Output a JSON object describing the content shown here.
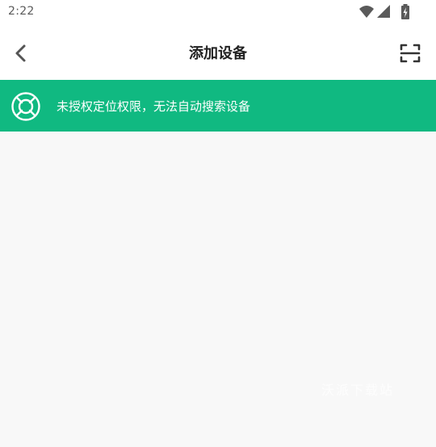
{
  "status_bar": {
    "time": "2:22",
    "icons": [
      "wifi-icon",
      "signal-icon",
      "battery-charging-icon"
    ]
  },
  "app_bar": {
    "title": "添加设备",
    "back_icon": "chevron-left-icon",
    "scan_icon": "scan-frame-icon"
  },
  "banner": {
    "icon": "location-target-icon",
    "text": "未授权定位权限，无法自动搜索设备",
    "color": "#10b981"
  },
  "watermark": {
    "text": "沃派下载站"
  }
}
